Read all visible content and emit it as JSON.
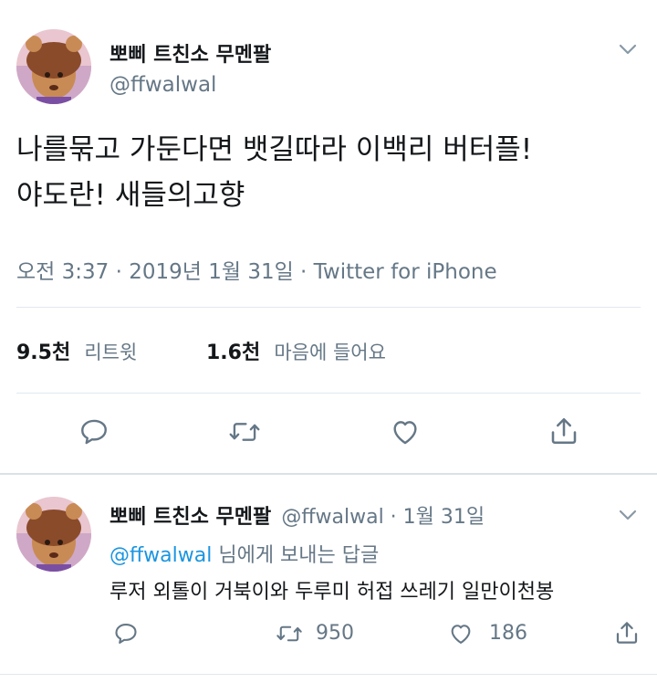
{
  "main_tweet": {
    "display_name": "뽀삐 트친소 무멘팔",
    "handle": "@ffwalwal",
    "text_line1": "나를묶고 가둔다면 뱃길따라 이백리 버터플!",
    "text_line2": "야도란! 새들의고향",
    "meta": "오전 3:37 · 2019년 1월 31일 · Twitter for iPhone",
    "retweet_count": "9.5천",
    "retweet_label": "리트윗",
    "like_count": "1.6천",
    "like_label": "마음에 들어요"
  },
  "reply_tweet": {
    "display_name": "뽀삐 트친소 무멘팔",
    "handle_date": "@ffwalwal · 1월 31일",
    "reply_to_handle": "@ffwalwal",
    "reply_to_suffix": " 님에게 보내는 답글",
    "text": "루저 외톨이 거북이와 두루미 허접 쓰레기 일만이천봉",
    "retweet_count": "950",
    "like_count": "186"
  },
  "icons": {
    "reply": "reply-icon",
    "retweet": "retweet-icon",
    "like": "heart-icon",
    "share": "share-icon",
    "menu": "chevron-down-icon"
  },
  "colors": {
    "text": "#14171a",
    "secondary": "#657786",
    "link": "#1b95e0",
    "divider": "#e1e8ed"
  }
}
